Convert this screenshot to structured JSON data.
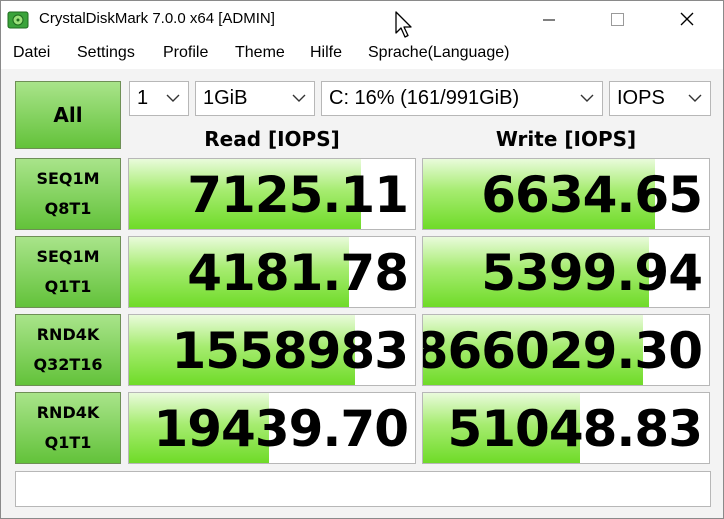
{
  "window": {
    "title": "CrystalDiskMark 7.0.0 x64 [ADMIN]"
  },
  "menu": [
    "Datei",
    "Settings",
    "Profile",
    "Theme",
    "Hilfe",
    "Sprache(Language)"
  ],
  "controls": {
    "all_label": "All",
    "count": "1",
    "size": "1GiB",
    "drive": "C: 16% (161/991GiB)",
    "unit": "IOPS"
  },
  "headers": {
    "read": "Read [IOPS]",
    "write": "Write [IOPS]"
  },
  "tests": [
    {
      "line1": "SEQ1M",
      "line2": "Q8T1",
      "read": "7125.11",
      "write": "6634.65",
      "read_fill": 0.81,
      "write_fill": 0.81
    },
    {
      "line1": "SEQ1M",
      "line2": "Q1T1",
      "read": "4181.78",
      "write": "5399.94",
      "read_fill": 0.77,
      "write_fill": 0.79
    },
    {
      "line1": "RND4K",
      "line2": "Q32T16",
      "read": "1558983",
      "write": "866029.30",
      "read_fill": 0.79,
      "write_fill": 0.77
    },
    {
      "line1": "RND4K",
      "line2": "Q1T1",
      "read": "19439.70",
      "write": "51048.83",
      "read_fill": 0.49,
      "write_fill": 0.55
    }
  ],
  "comment": "",
  "colors": {
    "bar": "#6fdb28",
    "button": "#63c23a"
  }
}
